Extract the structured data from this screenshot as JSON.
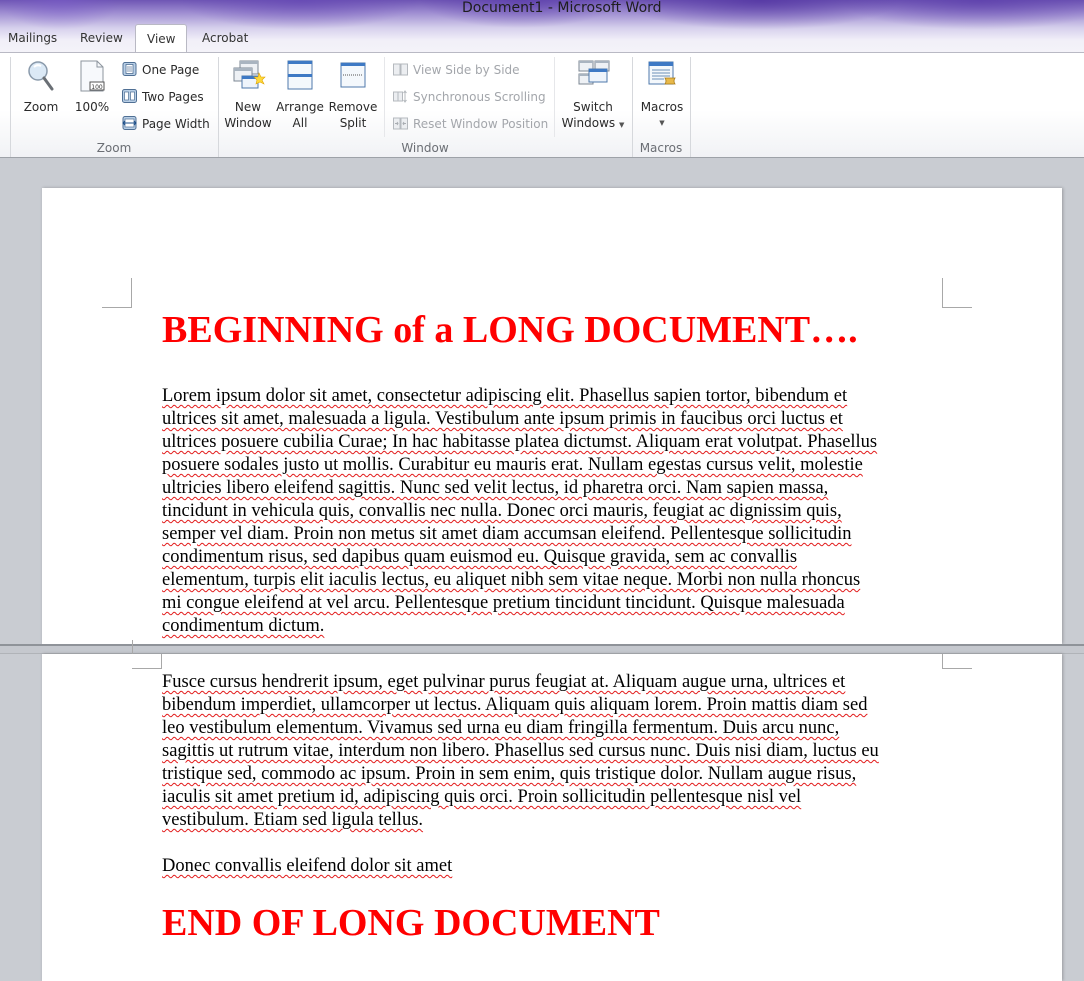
{
  "window": {
    "title": "Document1  -  Microsoft Word"
  },
  "tabs": [
    {
      "label": "Mailings",
      "active": false
    },
    {
      "label": "Review",
      "active": false
    },
    {
      "label": "View",
      "active": true
    },
    {
      "label": "Acrobat",
      "active": false
    }
  ],
  "ribbon": {
    "zoom_group": {
      "label": "Zoom",
      "zoom_button": "Zoom",
      "hundred_button": "100%",
      "hundred_icon_badge": "100",
      "one_page": "One Page",
      "two_pages": "Two Pages",
      "page_width": "Page Width"
    },
    "window_group": {
      "label": "Window",
      "new_window": [
        "New",
        "Window"
      ],
      "arrange_all": [
        "Arrange",
        "All"
      ],
      "remove_split": [
        "Remove",
        "Split"
      ],
      "view_side_by_side": "View Side by Side",
      "synchronous_scrolling": "Synchronous Scrolling",
      "reset_window_position": "Reset Window Position",
      "switch_windows": [
        "Switch",
        "Windows"
      ]
    },
    "macros_group": {
      "label": "Macros",
      "macros_button": "Macros"
    }
  },
  "document": {
    "top_pane": {
      "heading": "BEGINNING of a LONG DOCUMENT….",
      "paragraph_lines": [
        "Lorem ipsum dolor sit amet, consectetur adipiscing elit. Phasellus sapien tortor, bibendum et",
        "ultrices sit amet, malesuada a ligula. Vestibulum ante ipsum primis in faucibus orci luctus et",
        "ultrices posuere cubilia Curae; In hac habitasse platea dictumst. Aliquam erat volutpat. Phasellus",
        "posuere sodales justo ut mollis. Curabitur eu mauris erat. Nullam egestas cursus velit, molestie",
        "ultricies libero eleifend sagittis. Nunc sed velit lectus, id pharetra orci. Nam sapien massa,",
        "tincidunt in vehicula quis, convallis nec nulla. Donec orci mauris, feugiat ac dignissim quis,",
        "semper vel diam. Proin non metus sit amet diam accumsan eleifend. Pellentesque sollicitudin",
        "condimentum risus, sed dapibus quam euismod eu. Quisque gravida, sem ac convallis",
        "elementum, turpis elit iaculis lectus, eu aliquet nibh sem vitae neque. Morbi non nulla rhoncus",
        "mi congue eleifend at vel arcu. Pellentesque pretium tincidunt tincidunt. Quisque malesuada",
        "condimentum dictum."
      ]
    },
    "bottom_pane": {
      "paragraph_lines": [
        "Fusce cursus hendrerit ipsum, eget pulvinar purus feugiat at. Aliquam augue urna, ultrices et",
        "bibendum imperdiet, ullamcorper ut lectus. Aliquam quis aliquam lorem. Proin mattis diam sed",
        "leo vestibulum elementum. Vivamus sed urna eu diam fringilla fermentum. Duis arcu nunc,",
        "sagittis ut rutrum vitae, interdum non libero. Phasellus sed cursus nunc. Duis nisi diam, luctus eu",
        "tristique sed, commodo ac ipsum. Proin in sem enim, quis tristique dolor. Nullam augue risus,",
        "iaculis sit amet pretium id, adipiscing quis orci. Proin sollicitudin pellentesque nisl vel",
        "vestibulum. Etiam sed ligula tellus."
      ],
      "short_line": "Donec convallis eleifend dolor sit amet",
      "heading": "END OF LONG DOCUMENT"
    }
  },
  "colors": {
    "heading": "#ff0000",
    "spell_error_underline": "#e21a1a",
    "grammar_underline": "#2aa52a",
    "workspace": "#c9ccd2"
  }
}
